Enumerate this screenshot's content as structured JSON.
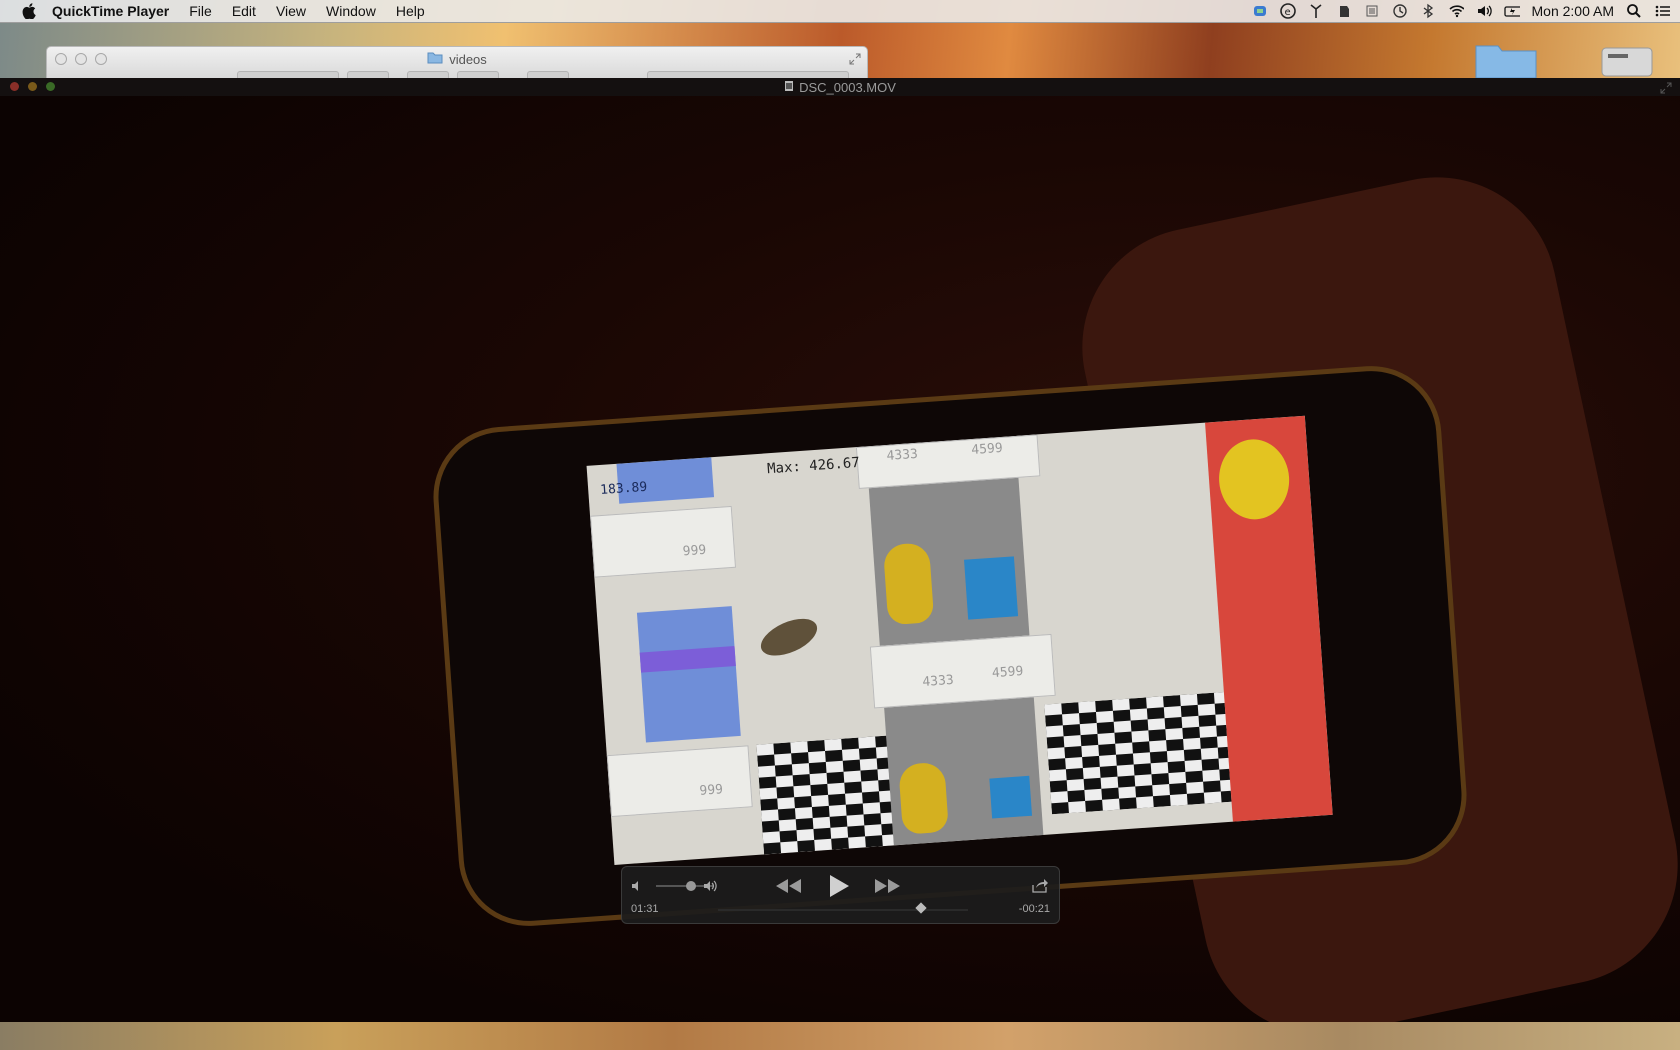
{
  "menubar": {
    "app_name": "QuickTime Player",
    "items": [
      "File",
      "Edit",
      "View",
      "Window",
      "Help"
    ],
    "clock": "Mon 2:00 AM"
  },
  "finder_window": {
    "title": "videos"
  },
  "player": {
    "window_title": "DSC_0003.MOV",
    "elapsed_time": "01:31",
    "remaining_time": "-00:21",
    "playback_progress": 0.81,
    "volume_level": 0.6
  },
  "video_frame": {
    "score": "183.89",
    "max_label": "Max: 426.67",
    "barrel_values": [
      "4333",
      "4599",
      "999",
      "4333",
      "4599",
      "999"
    ]
  },
  "colors": {
    "menubar_bg": "#ececec",
    "player_bg": "#0f0505",
    "hud_bg": "#1c1c1c",
    "close_red": "#e24b3f",
    "minimize_yellow": "#e0a824",
    "zoom_green": "#5bb43b"
  },
  "icons": {
    "menu_status": [
      "battery-icon",
      "tincan-icon",
      "antenna-icon",
      "evernote-icon",
      "list-icon",
      "time-machine-icon",
      "bluetooth-icon",
      "wifi-icon",
      "volume-icon",
      "battery-charge-icon",
      "spotlight-icon",
      "notification-center-icon"
    ]
  }
}
